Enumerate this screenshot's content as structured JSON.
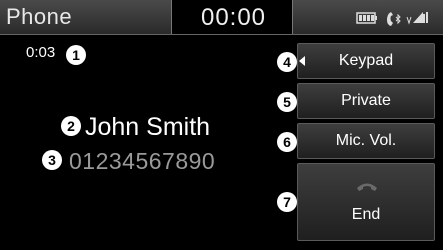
{
  "status_bar": {
    "app_title": "Phone",
    "clock": "00:00",
    "icons": [
      "battery-icon",
      "bluetooth-phone-icon",
      "signal-strength-icon"
    ]
  },
  "call": {
    "duration": "0:03",
    "contact_name": "John Smith",
    "phone_number": "01234567890"
  },
  "callouts": {
    "c1": "1",
    "c2": "2",
    "c3": "3",
    "c4": "4",
    "c5": "5",
    "c6": "6",
    "c7": "7"
  },
  "buttons": {
    "keypad": "Keypad",
    "private": "Private",
    "mic_vol": "Mic. Vol.",
    "end": "End",
    "end_icon": "hang-up-icon"
  },
  "colors": {
    "background": "#000000",
    "number_text": "#9a9a9a",
    "button_gradient_top": "#3e3e3e",
    "button_gradient_bottom": "#1f1f1f"
  }
}
